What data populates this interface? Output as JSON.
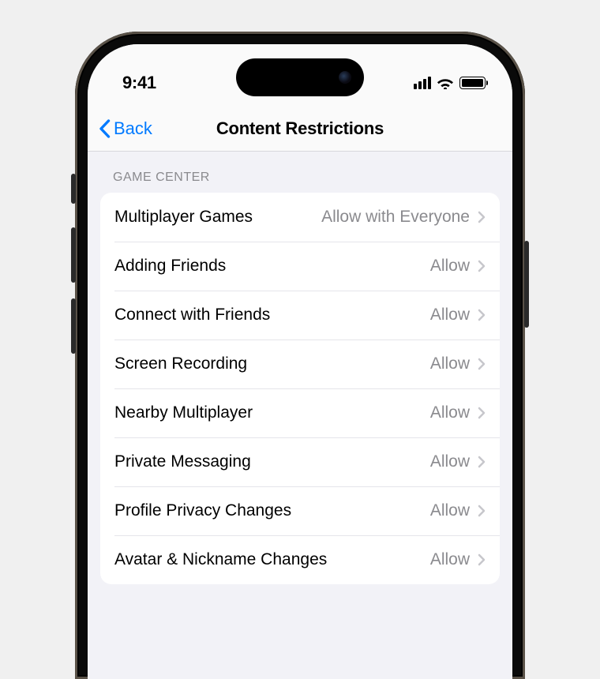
{
  "status": {
    "time": "9:41"
  },
  "nav": {
    "back_label": "Back",
    "title": "Content Restrictions"
  },
  "section": {
    "header": "GAME CENTER"
  },
  "rows": [
    {
      "label": "Multiplayer Games",
      "value": "Allow with Everyone"
    },
    {
      "label": "Adding Friends",
      "value": "Allow"
    },
    {
      "label": "Connect with Friends",
      "value": "Allow"
    },
    {
      "label": "Screen Recording",
      "value": "Allow"
    },
    {
      "label": "Nearby Multiplayer",
      "value": "Allow"
    },
    {
      "label": "Private Messaging",
      "value": "Allow"
    },
    {
      "label": "Profile Privacy Changes",
      "value": "Allow"
    },
    {
      "label": "Avatar & Nickname Changes",
      "value": "Allow"
    }
  ]
}
